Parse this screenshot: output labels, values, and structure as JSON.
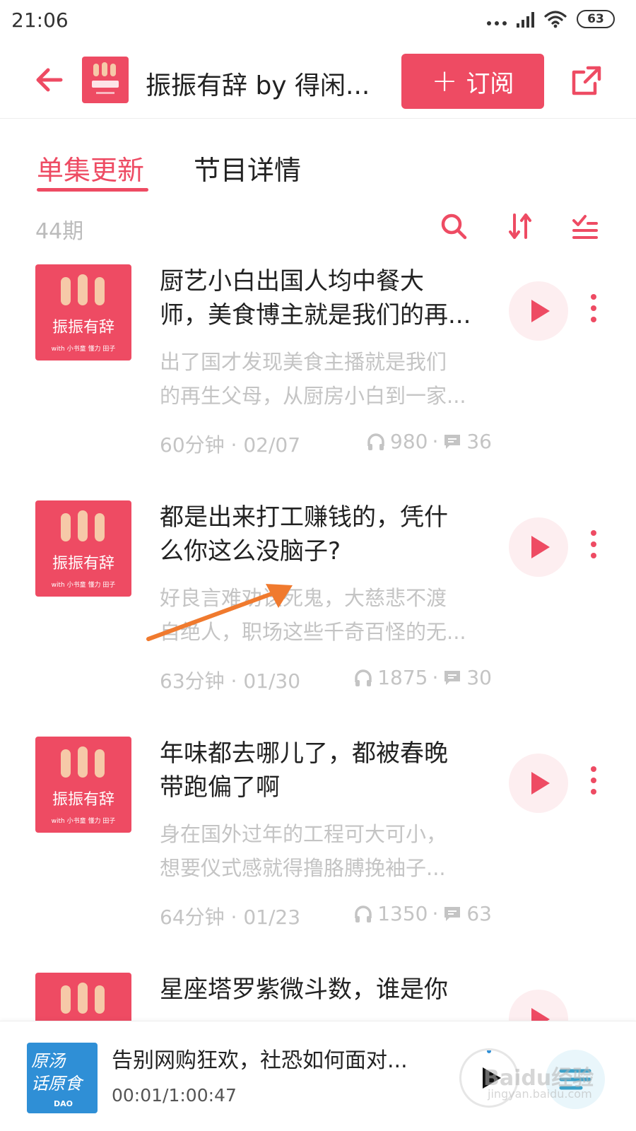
{
  "status_bar": {
    "time": "21:06",
    "battery": "63"
  },
  "header": {
    "title": "振振有辞 by 得闲...",
    "subscribe_label": "订阅",
    "cover_text": "振振有辞"
  },
  "tabs": {
    "active": "单集更新",
    "inactive": "节目详情"
  },
  "toolbar": {
    "episode_count": "44期"
  },
  "episodes": [
    {
      "title_line1": "厨艺小白出国人均中餐大",
      "title_line2": "师，美食博主就是我们的再...",
      "desc_line1": "出了国才发现美食主播就是我们",
      "desc_line2": "的再生父母，从厨房小白到一家...",
      "meta": "60分钟 · 02/07",
      "plays": "980",
      "comments": "36"
    },
    {
      "title_line1": "都是出来打工赚钱的，凭什",
      "title_line2": "么你这么没脑子?",
      "desc_line1": "好良言难劝该死鬼，大慈悲不渡",
      "desc_line2": "自绝人，职场这些千奇百怪的无...",
      "meta": "63分钟 · 01/30",
      "plays": "1875",
      "comments": "30"
    },
    {
      "title_line1": "年味都去哪儿了，都被春晚",
      "title_line2": "带跑偏了啊",
      "desc_line1": "身在国外过年的工程可大可小，",
      "desc_line2": "想要仪式感就得撸胳膊挽袖子...",
      "meta": "64分钟 · 01/23",
      "plays": "1350",
      "comments": "63"
    },
    {
      "title_line1": "星座塔罗紫微斗数，谁是你",
      "title_line2": "",
      "desc_line1": "",
      "desc_line2": "",
      "meta": "",
      "plays": "",
      "comments": ""
    }
  ],
  "cover_label": "振振有辞",
  "cover_sub": "with 小书童 懂力 田子",
  "mini_player": {
    "title": "告别网购狂欢，社恐如何面对...",
    "time": "00:01/1:00:47",
    "cover_text_line1": "原汤",
    "cover_text_line2": "话原食",
    "cover_sub": "DAO"
  },
  "watermark": {
    "main": "Baidu经验",
    "sub": "jingyan.baidu.com"
  },
  "colors": {
    "accent": "#ee4b63",
    "muted": "#c4c4c4",
    "annotation": "#f07a2e"
  }
}
